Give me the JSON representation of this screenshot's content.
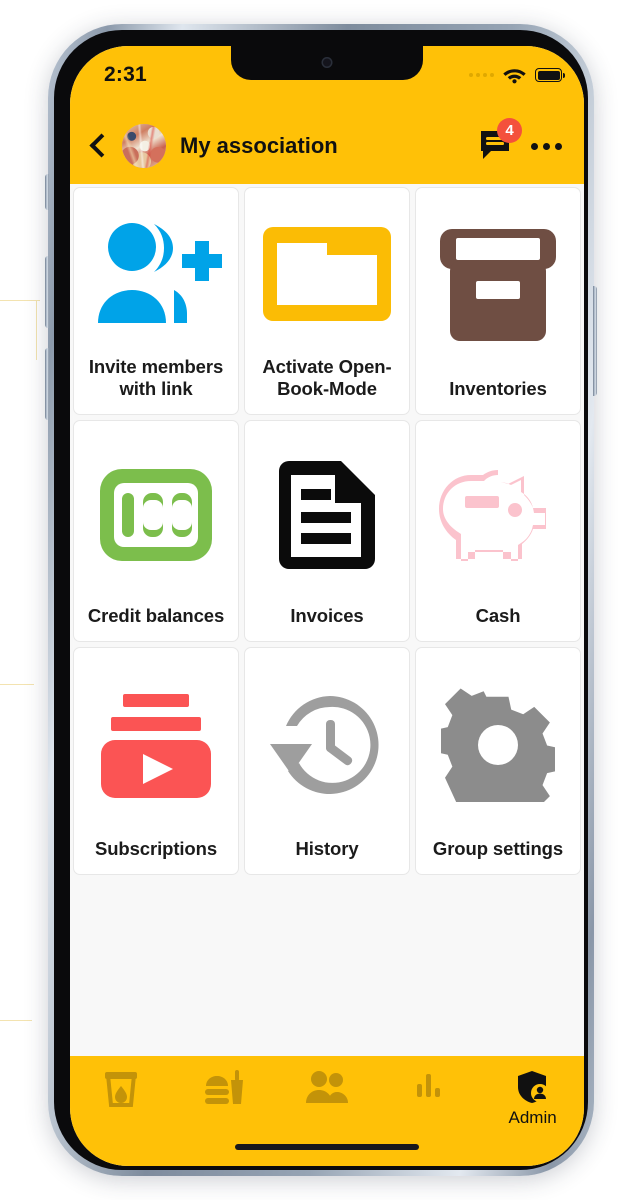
{
  "statusbar": {
    "time": "2:31",
    "cellular_icon": "cellular-dots-icon",
    "wifi_icon": "wifi-icon",
    "battery_icon": "battery-full-icon"
  },
  "header": {
    "back_icon": "chevron-left-icon",
    "avatar_name": "group-avatar",
    "title": "My association",
    "chat_icon": "chat-bubble-icon",
    "badge_count": "4",
    "overflow_icon": "more-options-icon"
  },
  "theme": {
    "brand_yellow": "#FFC107",
    "badge_red": "#F4513C",
    "page_bg": "#F8F8F8",
    "tile_bg": "#FFFFFF",
    "text_dark": "#1B1B1B"
  },
  "grid": {
    "tiles": [
      {
        "label": "Invite members with link",
        "icon": "add-person-icon",
        "color": "#00A3E8"
      },
      {
        "label": "Activate Open-Book-Mode",
        "icon": "open-folder-icon",
        "color": "#FBBC05"
      },
      {
        "label": "Inventories",
        "icon": "archive-box-icon",
        "color": "#6F4E43"
      },
      {
        "label": "Credit balances",
        "icon": "hundred-credits-icon",
        "color": "#7CBE4C"
      },
      {
        "label": "Invoices",
        "icon": "document-lines-icon",
        "color": "#0B0B0B"
      },
      {
        "label": "Cash",
        "icon": "piggy-bank-icon",
        "color": "#FBC3CD"
      },
      {
        "label": "Subscriptions",
        "icon": "subscriptions-play-icon",
        "color": "#FB5454"
      },
      {
        "label": "History",
        "icon": "history-clock-icon",
        "color": "#9E9E9E"
      },
      {
        "label": "Group settings",
        "icon": "gear-icon",
        "color": "#8C8C8C"
      }
    ]
  },
  "bottomnav": {
    "items": [
      {
        "label": "",
        "icon": "drink-glass-icon",
        "active": "false"
      },
      {
        "label": "",
        "icon": "fast-food-icon",
        "active": "false"
      },
      {
        "label": "",
        "icon": "people-group-icon",
        "active": "false"
      },
      {
        "label": "",
        "icon": "bar-chart-icon",
        "active": "false"
      },
      {
        "label": "Admin",
        "icon": "shield-person-icon",
        "active": "true"
      }
    ]
  }
}
